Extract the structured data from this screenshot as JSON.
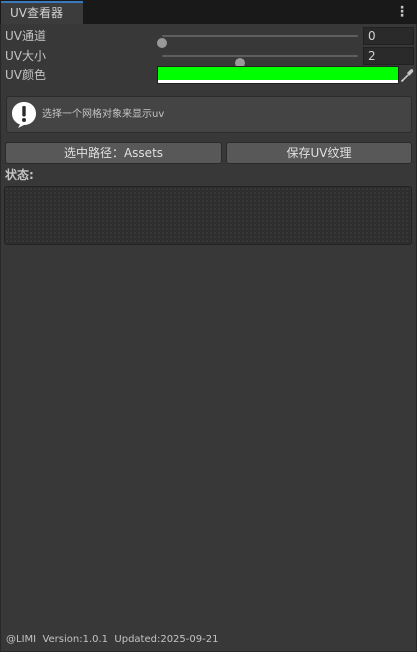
{
  "window": {
    "tab_title": "UV查看器",
    "menu_icon": "kebab-menu-icon"
  },
  "fields": {
    "uv_channel": {
      "label": "UV通道",
      "value": "0",
      "slider_fraction": 0.0
    },
    "uv_size": {
      "label": "UV大小",
      "value": "2",
      "slider_fraction": 0.4
    },
    "uv_color": {
      "label": "UV颜色",
      "color": "#00ff00",
      "picker_icon": "eyedropper-icon"
    }
  },
  "help": {
    "icon": "info-icon",
    "text": "选择一个网格对象来显示uv"
  },
  "buttons": {
    "path_label": "选中路径：Assets",
    "save_label": "保存UV纹理"
  },
  "status": {
    "label": "状态:"
  },
  "footer": {
    "text": "@LIMI  Version:1.0.1  Updated:2025-09-21"
  }
}
